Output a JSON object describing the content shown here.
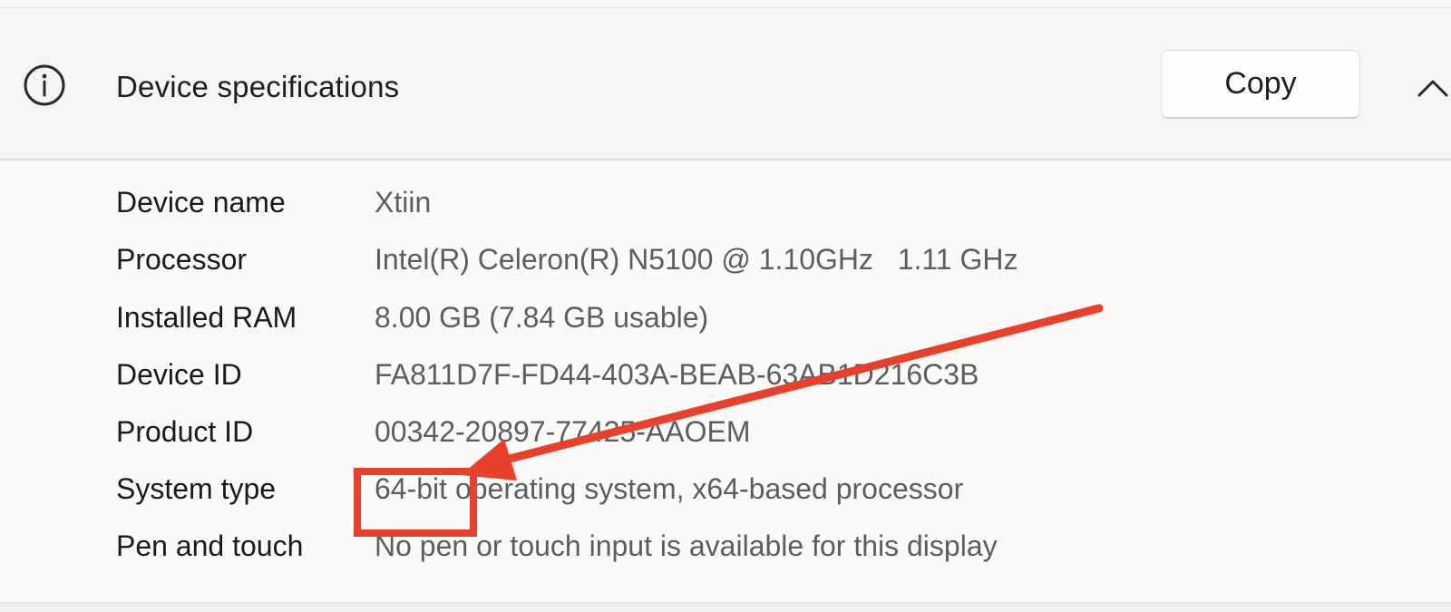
{
  "header": {
    "title": "Device specifications",
    "copy_label": "Copy",
    "icon": "info-icon",
    "collapse_icon": "chevron-up-icon"
  },
  "specs": [
    {
      "label": "Device name",
      "value": "Xtiin"
    },
    {
      "label": "Processor",
      "value": "Intel(R) Celeron(R) N5100 @ 1.10GHz   1.11 GHz"
    },
    {
      "label": "Installed RAM",
      "value": "8.00 GB (7.84 GB usable)"
    },
    {
      "label": "Device ID",
      "value": "FA811D7F-FD44-403A-BEAB-63AB1D216C3B"
    },
    {
      "label": "Product ID",
      "value": "00342-20897-77425-AAOEM"
    },
    {
      "label": "System type",
      "value": "64-bit operating system, x64-based processor"
    },
    {
      "label": "Pen and touch",
      "value": "No pen or touch input is available for this display"
    }
  ],
  "annotation": {
    "color": "#e8402a",
    "type": "highlight-box-with-arrow",
    "target": "64-bit"
  }
}
